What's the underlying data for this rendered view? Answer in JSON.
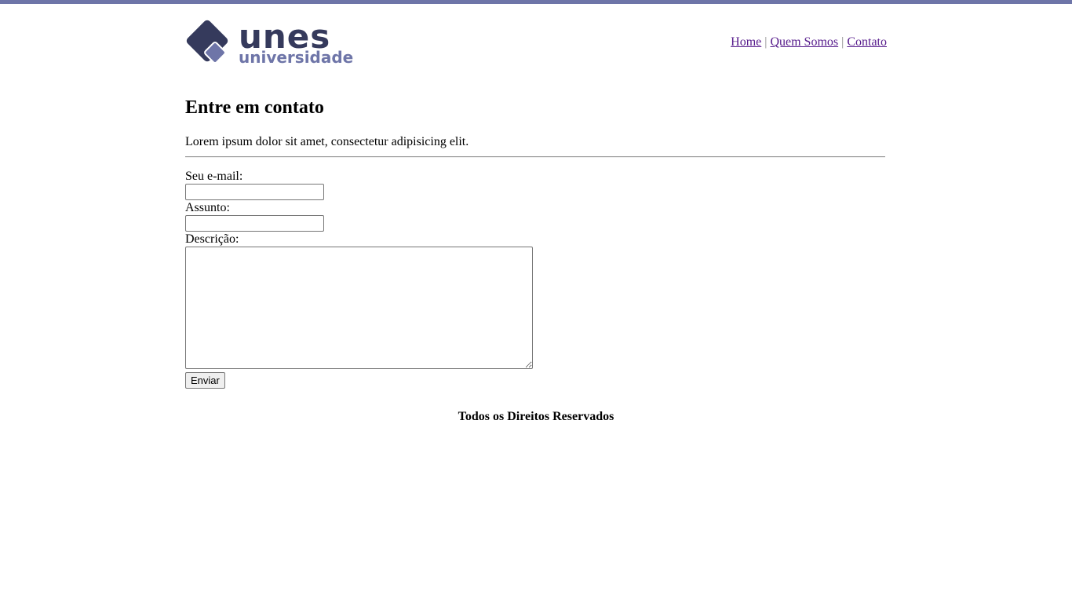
{
  "brand": {
    "logo_word": "unes",
    "logo_sub": "universidade",
    "logo_dark": "#353a5c",
    "logo_light": "#6e75a8"
  },
  "theme": {
    "accent": "#6e75a8",
    "link": "#551a8b"
  },
  "nav": {
    "items": [
      {
        "label": "Home"
      },
      {
        "label": "Quem Somos"
      },
      {
        "label": "Contato"
      }
    ],
    "separator": "|"
  },
  "main": {
    "title": "Entre em contato",
    "intro": "Lorem ipsum dolor sit amet, consectetur adipisicing elit."
  },
  "form": {
    "email_label": "Seu e-mail:",
    "email_value": "",
    "subject_label": "Assunto:",
    "subject_value": "",
    "description_label": "Descrição:",
    "description_value": "",
    "submit_label": "Enviar"
  },
  "footer": {
    "text": "Todos os Direitos Reservados"
  }
}
